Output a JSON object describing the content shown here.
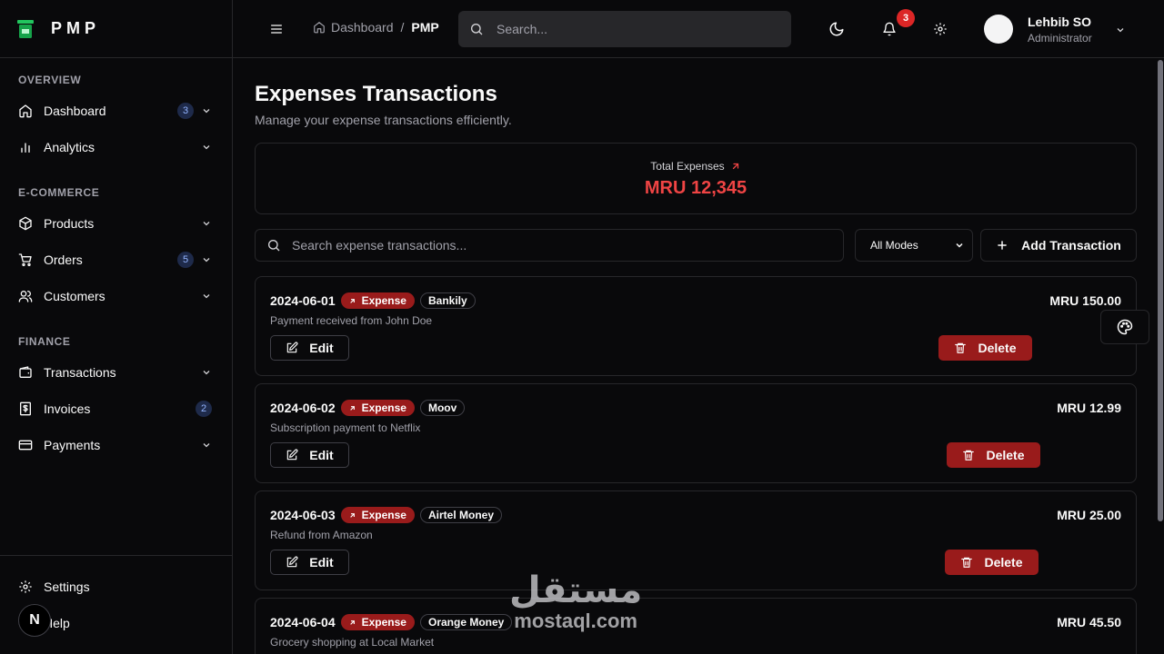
{
  "app": {
    "name": "PMP"
  },
  "sidebar": {
    "sections": [
      {
        "title": "OVERVIEW",
        "items": [
          {
            "label": "Dashboard",
            "icon": "home-icon",
            "badge": "3",
            "chevron": true
          },
          {
            "label": "Analytics",
            "icon": "bar-chart-icon",
            "badge": "",
            "chevron": true
          }
        ]
      },
      {
        "title": "E-COMMERCE",
        "items": [
          {
            "label": "Products",
            "icon": "package-icon",
            "badge": "",
            "chevron": true
          },
          {
            "label": "Orders",
            "icon": "cart-icon",
            "badge": "5",
            "chevron": true
          },
          {
            "label": "Customers",
            "icon": "users-icon",
            "badge": "",
            "chevron": true
          }
        ]
      },
      {
        "title": "FINANCE",
        "items": [
          {
            "label": "Transactions",
            "icon": "wallet-icon",
            "badge": "",
            "chevron": true
          },
          {
            "label": "Invoices",
            "icon": "receipt-icon",
            "badge": "2",
            "chevron": false
          },
          {
            "label": "Payments",
            "icon": "credit-card-icon",
            "badge": "",
            "chevron": true
          }
        ]
      }
    ],
    "footer": {
      "settings": "Settings",
      "help": "Help"
    }
  },
  "header": {
    "breadcrumb": {
      "home": "Dashboard",
      "separator": "/",
      "current": "PMP"
    },
    "search_placeholder": "Search...",
    "notification_count": "3",
    "user": {
      "name": "Lehbib SO",
      "role": "Administrator"
    }
  },
  "page": {
    "title": "Expenses Transactions",
    "subtitle": "Manage your expense transactions efficiently.",
    "stat": {
      "label": "Total Expenses",
      "value": "MRU 12,345",
      "color": "#ef4444"
    },
    "search_placeholder": "Search expense transactions...",
    "mode_filter": "All Modes",
    "add_label": "Add Transaction",
    "edit_label": "Edit",
    "delete_label": "Delete"
  },
  "transactions": [
    {
      "date": "2024-06-01",
      "type": "Expense",
      "mode": "Bankily",
      "description": "Payment received from John Doe",
      "amount": "MRU 150.00"
    },
    {
      "date": "2024-06-02",
      "type": "Expense",
      "mode": "Moov",
      "description": "Subscription payment to Netflix",
      "amount": "MRU 12.99"
    },
    {
      "date": "2024-06-03",
      "type": "Expense",
      "mode": "Airtel Money",
      "description": "Refund from Amazon",
      "amount": "MRU 25.00"
    },
    {
      "date": "2024-06-04",
      "type": "Expense",
      "mode": "Orange Money",
      "description": "Grocery shopping at Local Market",
      "amount": "MRU 45.50"
    }
  ],
  "watermark": {
    "arabic": "مستقل",
    "latin": "mostaql.com"
  },
  "colors": {
    "background": "#09090b",
    "border": "#27272a",
    "danger": "#991b1b",
    "accent_red": "#ef4444"
  }
}
